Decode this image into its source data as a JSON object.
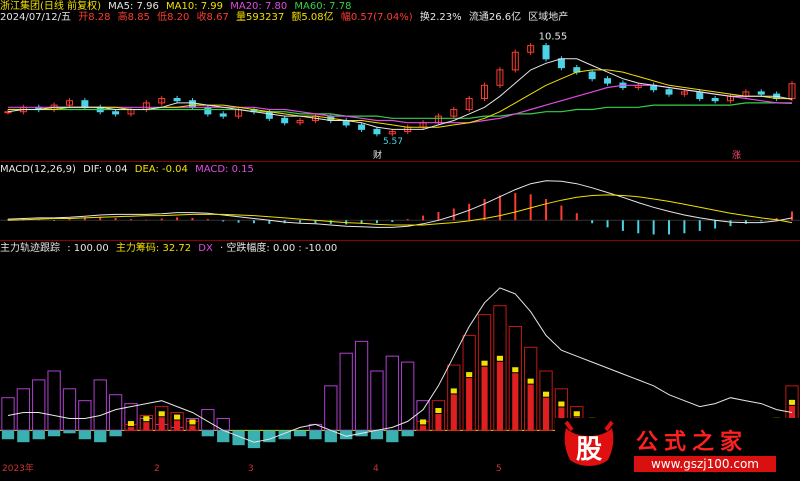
{
  "header": {
    "title": "浙江集团(日线 前复权)",
    "ma5": "MA5: 7.96",
    "ma10": "MA10: 7.99",
    "ma20": "MA20: 7.80",
    "ma60": "MA60: 7.78",
    "date": "2024/07/12/五",
    "open": "开8.28",
    "high": "高8.85",
    "low": "低8.20",
    "close": "收8.67",
    "volume": "量593237",
    "amount": "额5.08亿",
    "change": "幅0.57(7.04%)",
    "turnover": "换2.23%",
    "float": "流通26.6亿",
    "region": "区域地产"
  },
  "macd_header": {
    "name": "MACD(12,26,9)",
    "dif": "DIF: 0.04",
    "dea": "DEA: -0.04",
    "macd": "MACD: 0.15"
  },
  "ind_header": {
    "name": "主力轨迹跟踪",
    "v1": ": 100.00",
    "v2": "主力筹码: 32.72",
    "dx": "DX",
    "v3": "· 空跌幅度: 0.00 : -10.00"
  },
  "annotations": {
    "high_label": "10.55",
    "low_label": "5.57",
    "badge_cai": "财",
    "badge_zhang": "涨"
  },
  "x_axis": {
    "year": "2023年",
    "ticks": [
      "2",
      "3",
      "4",
      "5"
    ]
  },
  "watermark": {
    "logo_char": "股",
    "title": "公式之家",
    "url": "www.gszj100.com"
  },
  "colors": {
    "up": "#ff3b30",
    "down": "#4bd3e6",
    "ma5": "#e6e6e6",
    "ma10": "#f2e000",
    "ma20": "#e04ce0",
    "ma60": "#35d14a"
  },
  "chart_data": [
    {
      "type": "line",
      "name": "price",
      "x": [
        "2023年",
        "2",
        "3",
        "4",
        "5"
      ],
      "close": [
        7.4,
        7.6,
        7.5,
        7.7,
        7.9,
        7.6,
        7.4,
        7.3,
        7.5,
        7.8,
        8.0,
        7.9,
        7.6,
        7.3,
        7.2,
        7.5,
        7.4,
        7.1,
        6.9,
        7.0,
        7.2,
        7.0,
        6.8,
        6.6,
        6.4,
        6.5,
        6.7,
        6.9,
        7.2,
        7.5,
        8.0,
        8.6,
        9.3,
        10.1,
        10.4,
        9.8,
        9.4,
        9.2,
        8.9,
        8.7,
        8.5,
        8.6,
        8.4,
        8.2,
        8.3,
        8.0,
        7.9,
        8.1,
        8.3,
        8.2,
        8.0,
        8.67
      ],
      "ma5": [
        7.4,
        7.5,
        7.5,
        7.6,
        7.6,
        7.6,
        7.6,
        7.5,
        7.5,
        7.5,
        7.6,
        7.8,
        7.8,
        7.7,
        7.6,
        7.5,
        7.4,
        7.3,
        7.2,
        7.2,
        7.1,
        7.0,
        7.0,
        6.9,
        6.7,
        6.6,
        6.6,
        6.6,
        6.8,
        7.0,
        7.3,
        7.6,
        8.1,
        8.7,
        9.3,
        9.6,
        9.8,
        9.8,
        9.5,
        9.2,
        8.9,
        8.7,
        8.6,
        8.5,
        8.4,
        8.3,
        8.2,
        8.1,
        8.1,
        8.1,
        8.1,
        7.96
      ],
      "ma10": [
        7.5,
        7.5,
        7.5,
        7.5,
        7.6,
        7.6,
        7.6,
        7.6,
        7.5,
        7.5,
        7.6,
        7.6,
        7.7,
        7.7,
        7.7,
        7.6,
        7.5,
        7.4,
        7.3,
        7.2,
        7.2,
        7.1,
        7.0,
        7.0,
        6.9,
        6.8,
        6.7,
        6.7,
        6.7,
        6.8,
        6.9,
        7.1,
        7.4,
        7.8,
        8.2,
        8.6,
        8.9,
        9.2,
        9.3,
        9.3,
        9.2,
        9.0,
        8.8,
        8.6,
        8.5,
        8.4,
        8.3,
        8.2,
        8.1,
        8.1,
        8.0,
        7.99
      ],
      "ma20": [
        7.6,
        7.6,
        7.6,
        7.6,
        7.6,
        7.6,
        7.6,
        7.6,
        7.6,
        7.6,
        7.6,
        7.6,
        7.6,
        7.6,
        7.6,
        7.6,
        7.6,
        7.5,
        7.5,
        7.4,
        7.3,
        7.2,
        7.2,
        7.1,
        7.0,
        7.0,
        6.9,
        6.9,
        6.9,
        6.9,
        6.9,
        7.0,
        7.1,
        7.3,
        7.5,
        7.7,
        7.9,
        8.1,
        8.3,
        8.5,
        8.6,
        8.6,
        8.6,
        8.5,
        8.4,
        8.3,
        8.2,
        8.1,
        8.0,
        7.9,
        7.8,
        7.8
      ],
      "ma60": [
        7.5,
        7.5,
        7.5,
        7.5,
        7.5,
        7.5,
        7.5,
        7.5,
        7.5,
        7.5,
        7.5,
        7.5,
        7.5,
        7.5,
        7.5,
        7.5,
        7.4,
        7.4,
        7.4,
        7.3,
        7.3,
        7.3,
        7.2,
        7.2,
        7.2,
        7.1,
        7.1,
        7.1,
        7.1,
        7.1,
        7.1,
        7.2,
        7.2,
        7.3,
        7.3,
        7.4,
        7.4,
        7.5,
        7.5,
        7.6,
        7.6,
        7.6,
        7.7,
        7.7,
        7.7,
        7.7,
        7.7,
        7.7,
        7.8,
        7.8,
        7.8,
        7.78
      ],
      "ylim": [
        5.3,
        11.2
      ]
    },
    {
      "type": "bar",
      "name": "MACD",
      "values": [
        0.02,
        0.03,
        0.01,
        -0.01,
        0.02,
        0.05,
        0.06,
        0.04,
        0.02,
        0.01,
        0.03,
        0.05,
        0.04,
        0.02,
        -0.02,
        -0.04,
        -0.05,
        -0.06,
        -0.05,
        -0.04,
        -0.05,
        -0.06,
        -0.07,
        -0.06,
        -0.05,
        -0.03,
        0.02,
        0.08,
        0.14,
        0.2,
        0.28,
        0.36,
        0.42,
        0.46,
        0.44,
        0.36,
        0.25,
        0.12,
        -0.05,
        -0.12,
        -0.18,
        -0.22,
        -0.24,
        -0.24,
        -0.22,
        -0.18,
        -0.14,
        -0.1,
        -0.06,
        -0.02,
        0.04,
        0.15
      ],
      "dif": [
        0.02,
        0.03,
        0.04,
        0.04,
        0.05,
        0.07,
        0.09,
        0.1,
        0.1,
        0.1,
        0.11,
        0.13,
        0.13,
        0.12,
        0.09,
        0.06,
        0.03,
        0.0,
        -0.03,
        -0.05,
        -0.06,
        -0.08,
        -0.1,
        -0.11,
        -0.12,
        -0.12,
        -0.1,
        -0.06,
        0.0,
        0.08,
        0.17,
        0.28,
        0.4,
        0.52,
        0.62,
        0.67,
        0.66,
        0.62,
        0.55,
        0.47,
        0.39,
        0.3,
        0.22,
        0.15,
        0.09,
        0.04,
        0.0,
        -0.03,
        -0.04,
        -0.04,
        -0.01,
        0.04
      ],
      "dea": [
        0.0,
        0.01,
        0.02,
        0.03,
        0.03,
        0.04,
        0.05,
        0.06,
        0.07,
        0.08,
        0.08,
        0.09,
        0.1,
        0.1,
        0.1,
        0.09,
        0.08,
        0.06,
        0.04,
        0.02,
        0.0,
        -0.02,
        -0.04,
        -0.05,
        -0.07,
        -0.08,
        -0.08,
        -0.08,
        -0.06,
        -0.04,
        -0.01,
        0.03,
        0.08,
        0.14,
        0.21,
        0.28,
        0.34,
        0.39,
        0.42,
        0.43,
        0.42,
        0.4,
        0.36,
        0.32,
        0.27,
        0.22,
        0.17,
        0.12,
        0.08,
        0.04,
        0.01,
        -0.04
      ],
      "ylim": [
        -0.3,
        0.75
      ]
    },
    {
      "type": "bar",
      "name": "主力轨迹跟踪",
      "purple": [
        22,
        28,
        34,
        40,
        28,
        20,
        34,
        24,
        18,
        8,
        4,
        2,
        8,
        14,
        8,
        0,
        0,
        0,
        0,
        0,
        4,
        30,
        52,
        60,
        40,
        50,
        46,
        20,
        0,
        0,
        0,
        0,
        0,
        0,
        0,
        0,
        0,
        0,
        0,
        0,
        0,
        0,
        0,
        0,
        0,
        0,
        0,
        0,
        0,
        0,
        0,
        0
      ],
      "red": [
        0,
        0,
        0,
        0,
        0,
        0,
        0,
        0,
        4,
        10,
        16,
        12,
        6,
        0,
        0,
        0,
        0,
        0,
        0,
        0,
        0,
        0,
        0,
        0,
        0,
        0,
        0,
        6,
        20,
        44,
        64,
        78,
        84,
        70,
        56,
        40,
        28,
        16,
        8,
        0,
        0,
        0,
        0,
        0,
        0,
        0,
        0,
        0,
        0,
        0,
        8,
        30
      ],
      "cyan": [
        -6,
        -8,
        -6,
        -4,
        -2,
        -6,
        -8,
        -4,
        0,
        0,
        0,
        0,
        0,
        -4,
        -8,
        -10,
        -12,
        -8,
        -6,
        -4,
        -6,
        -8,
        -6,
        -4,
        -6,
        -8,
        -4,
        0,
        0,
        0,
        0,
        0,
        0,
        0,
        0,
        0,
        0,
        0,
        0,
        0,
        0,
        0,
        0,
        0,
        0,
        0,
        0,
        0,
        0,
        0,
        0,
        0
      ],
      "white_line": [
        10,
        12,
        12,
        10,
        8,
        8,
        10,
        14,
        16,
        18,
        20,
        16,
        12,
        6,
        0,
        -4,
        -8,
        -6,
        -2,
        2,
        4,
        0,
        -4,
        -2,
        0,
        2,
        6,
        14,
        30,
        50,
        70,
        86,
        96,
        92,
        80,
        64,
        54,
        50,
        46,
        42,
        38,
        34,
        30,
        24,
        20,
        16,
        18,
        22,
        20,
        18,
        14,
        12
      ],
      "ylim": [
        -20,
        100
      ]
    }
  ]
}
